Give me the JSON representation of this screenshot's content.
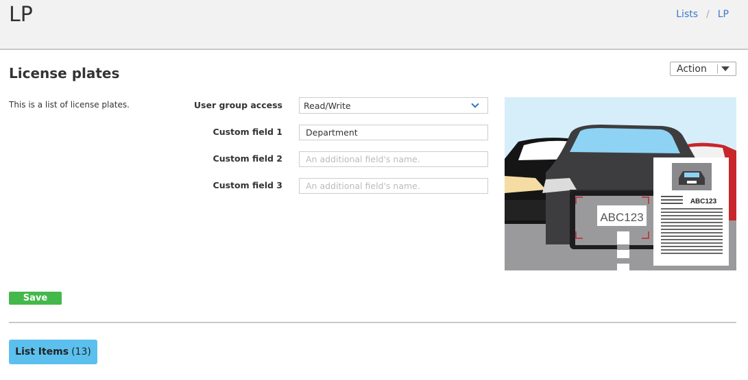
{
  "header": {
    "title": "LP",
    "breadcrumb": {
      "items": [
        "Lists",
        "LP"
      ],
      "separator": "/"
    }
  },
  "section": {
    "title": "License plates",
    "description": "This is a list of license plates."
  },
  "action_menu": {
    "label": "Action"
  },
  "form": {
    "user_group_access": {
      "label": "User group access",
      "value": "Read/Write"
    },
    "custom_field_1": {
      "label": "Custom field 1",
      "value": "Department",
      "placeholder": ""
    },
    "custom_field_2": {
      "label": "Custom field 2",
      "value": "",
      "placeholder": "An additional field's name."
    },
    "custom_field_3": {
      "label": "Custom field 3",
      "value": "",
      "placeholder": "An additional field's name."
    }
  },
  "illustration": {
    "plate_text": "ABC123",
    "doc_plate_text": "ABC123"
  },
  "save": {
    "label": "Save"
  },
  "list_items": {
    "label": "List Items",
    "count": "(13)"
  },
  "colors": {
    "accent": "#3a78c9",
    "save": "#44b84a",
    "list_button": "#5bc0ee",
    "header_bg": "#f2f2f2"
  }
}
